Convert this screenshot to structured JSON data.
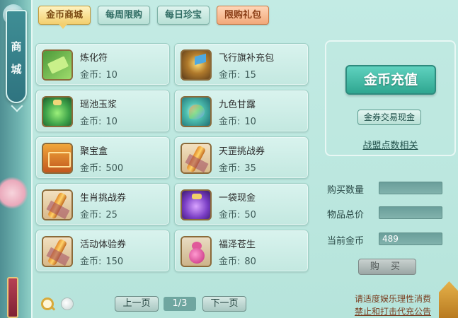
{
  "side_tab": {
    "chars": [
      "商",
      "城"
    ]
  },
  "tabs": [
    {
      "label": "金币商城",
      "state": "active"
    },
    {
      "label": "每周限购",
      "state": "normal"
    },
    {
      "label": "每日珍宝",
      "state": "normal"
    },
    {
      "label": "限购礼包",
      "state": "highlight"
    }
  ],
  "currency_label": "金币:",
  "items": [
    {
      "name": "炼化符",
      "price": "10",
      "icon": "talisman-icon"
    },
    {
      "name": "飞行旗补充包",
      "price": "15",
      "icon": "flag-pack-icon"
    },
    {
      "name": "瑶池玉浆",
      "price": "10",
      "icon": "jade-pot-icon"
    },
    {
      "name": "九色甘露",
      "price": "10",
      "icon": "gem-dew-icon"
    },
    {
      "name": "聚宝盒",
      "price": "500",
      "icon": "treasure-box-icon"
    },
    {
      "name": "天罡挑战券",
      "price": "35",
      "icon": "scroll-icon"
    },
    {
      "name": "生肖挑战券",
      "price": "25",
      "icon": "scroll-icon"
    },
    {
      "name": "一袋现金",
      "price": "50",
      "icon": "money-bag-icon"
    },
    {
      "name": "活动体验券",
      "price": "150",
      "icon": "scroll-icon"
    },
    {
      "name": "福泽苍生",
      "price": "80",
      "icon": "gourd-icon"
    }
  ],
  "recharge": {
    "button": "金币充值",
    "exchange": "金券交易现金",
    "alliance_link": "战盟点数相关"
  },
  "purchase": {
    "qty_label": "购买数量",
    "qty_value": "",
    "total_label": "物品总价",
    "total_value": "",
    "coins_label": "当前金币",
    "coins_value": "489",
    "buy_button": "购 买"
  },
  "pagination": {
    "prev": "上一页",
    "page": "1/3",
    "next": "下一页"
  },
  "notice": {
    "line1": "请适度娱乐理性消费",
    "line2": "禁止和打击代充公告"
  }
}
